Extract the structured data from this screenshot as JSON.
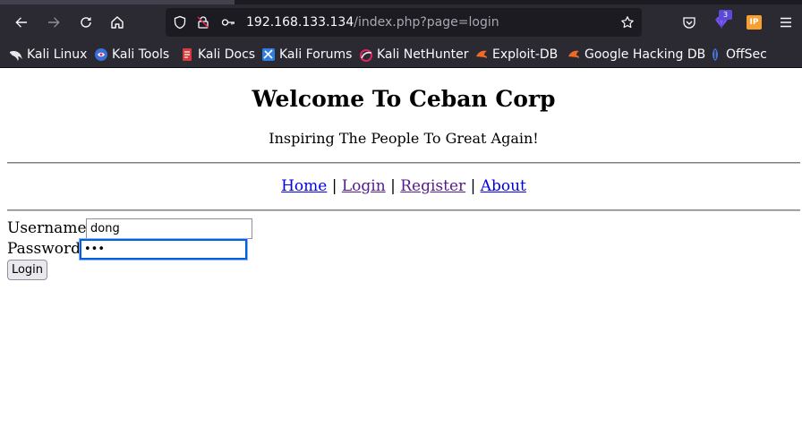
{
  "browser": {
    "url_host": "192.168.133.134",
    "url_path": "/index.php?page=login",
    "extension_badge": "3",
    "ip_extension_label": "IP",
    "bookmarks": [
      {
        "label": "Kali Linux",
        "icon": "kali-dragon-icon"
      },
      {
        "label": "Kali Tools",
        "icon": "kali-tools-icon"
      },
      {
        "label": "Kali Docs",
        "icon": "kali-docs-icon"
      },
      {
        "label": "Kali Forums",
        "icon": "kali-forums-icon"
      },
      {
        "label": "Kali NetHunter",
        "icon": "nethunter-icon"
      },
      {
        "label": "Exploit-DB",
        "icon": "exploit-db-icon"
      },
      {
        "label": "Google Hacking DB",
        "icon": "ghdb-icon"
      },
      {
        "label": "OffSec",
        "icon": "offsec-icon"
      }
    ]
  },
  "page": {
    "title": "Welcome To Ceban Corp",
    "subtitle": "Inspiring The People To Great Again!",
    "nav": [
      {
        "label": "Home"
      },
      {
        "label": "Login"
      },
      {
        "label": "Register"
      },
      {
        "label": "About"
      }
    ],
    "nav_separator": "|",
    "form": {
      "username_label": "Username",
      "username_value": "dong",
      "password_label": "Password",
      "password_value": "•••",
      "submit_label": "Login"
    }
  },
  "colors": {
    "chrome_bg": "#2b2a33",
    "urlbar_bg": "#1c1b22",
    "link_unvisited": "#0000ee",
    "link_visited": "#551a8b",
    "focus_ring": "#0060df"
  }
}
